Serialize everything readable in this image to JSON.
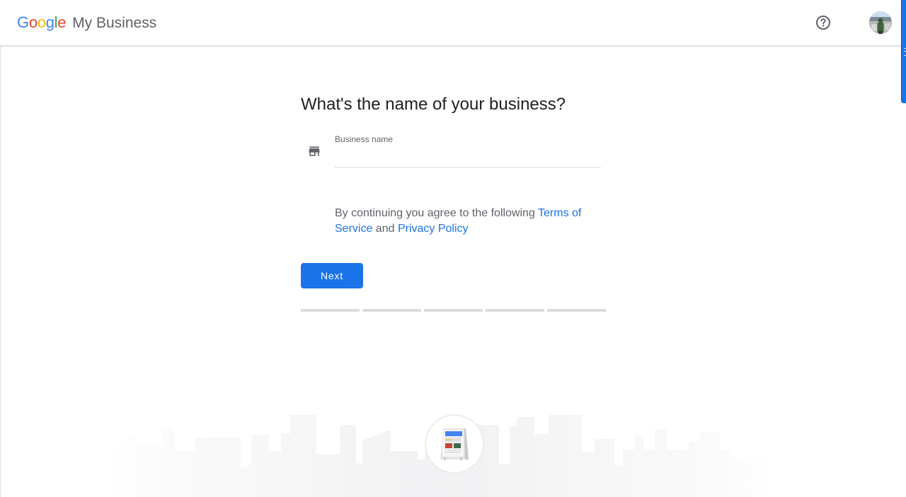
{
  "header": {
    "logo_google": [
      "G",
      "o",
      "o",
      "g",
      "l",
      "e"
    ],
    "logo_colors": [
      "#4285f4",
      "#ea4335",
      "#fbbc05",
      "#4285f4",
      "#34a853",
      "#ea4335"
    ],
    "product_name": "My Business",
    "help_icon": "help-circle-icon",
    "avatar_alt": "Account avatar"
  },
  "form": {
    "title": "What's the name of your business?",
    "field_icon": "store-icon",
    "field_label": "Business name",
    "field_value": "",
    "field_placeholder": "",
    "terms_prefix": "By continuing you agree to the following ",
    "terms_link": "Terms of Service",
    "terms_middle": " and ",
    "privacy_link": "Privacy Policy",
    "next_label": "Next",
    "progress": {
      "total_steps": 5,
      "completed_steps": 0
    }
  },
  "colors": {
    "accent": "#1a73e8",
    "text_primary": "#202124",
    "text_secondary": "#5f6368",
    "divider": "#dadce0"
  },
  "illustration": "storefront-sign-illustration"
}
